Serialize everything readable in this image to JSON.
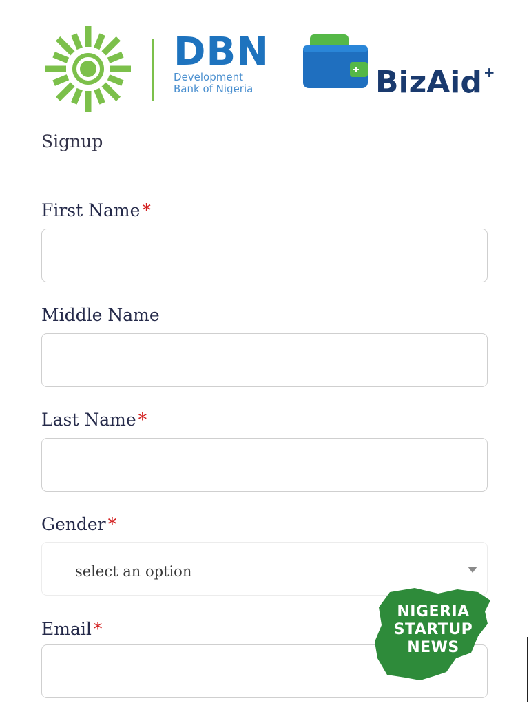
{
  "header": {
    "dbn_title": "DBN",
    "dbn_sub_line1": "Development",
    "dbn_sub_line2": "Bank of Nigeria",
    "bizaid_word": "BizAid",
    "bizaid_plus": "+",
    "icons": [
      "dbn-sun-logo",
      "bizaid-wallet-logo"
    ],
    "colors": {
      "dbn_green": "#7cc04b",
      "dbn_blue": "#1e73be",
      "bizaid_navy": "#1a3a6e",
      "wallet_blue": "#1f6fbf",
      "wallet_green": "#55b847"
    }
  },
  "form": {
    "heading": "Signup",
    "required_marker": "*",
    "fields": [
      {
        "label": "First Name",
        "required": true,
        "value": ""
      },
      {
        "label": "Middle Name",
        "required": false,
        "value": ""
      },
      {
        "label": "Last Name",
        "required": true,
        "value": ""
      },
      {
        "label": "Gender",
        "required": true,
        "selected": "select an option"
      },
      {
        "label": "Email",
        "required": true,
        "value": ""
      }
    ],
    "colors": {
      "required_star": "#d32020",
      "label_text": "#252a4a",
      "input_border": "#cfcfcf"
    }
  },
  "watermark": {
    "line1": "NIGERIA",
    "line2": "STARTUP",
    "line3": "NEWS",
    "color": "#2e8b3a"
  }
}
